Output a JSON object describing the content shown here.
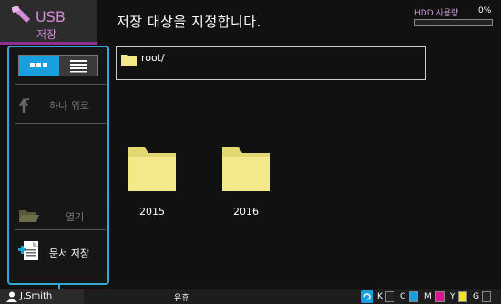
{
  "header": {
    "tab_label": "USB",
    "tab_sublabel": "저장",
    "title": "저장 대상을 지정합니다.",
    "hdd_label": "HDD 사용량",
    "hdd_percent": "0%",
    "hdd_fill_fraction": 0.0
  },
  "sidebar": {
    "view_grid_icon": "grid-view-icon",
    "view_list_icon": "list-view-icon",
    "up_label": "하나 위로",
    "open_label": "열기",
    "save_label": "문서 저장"
  },
  "path": {
    "text": "root/"
  },
  "folders": [
    {
      "name": "2015"
    },
    {
      "name": "2016"
    }
  ],
  "status": {
    "user": "J.Smith",
    "state": "유휴",
    "toner": [
      {
        "label": "K",
        "color": "#222222"
      },
      {
        "label": "C",
        "color": "#1a9fde"
      },
      {
        "label": "M",
        "color": "#d6168b"
      },
      {
        "label": "Y",
        "color": "#f0e21e"
      },
      {
        "label": "G",
        "color": "#222222"
      }
    ]
  },
  "colors": {
    "accent": "#35a8d8",
    "usb_purple": "#d48bd8",
    "folder_yellow": "#f3e98a"
  }
}
